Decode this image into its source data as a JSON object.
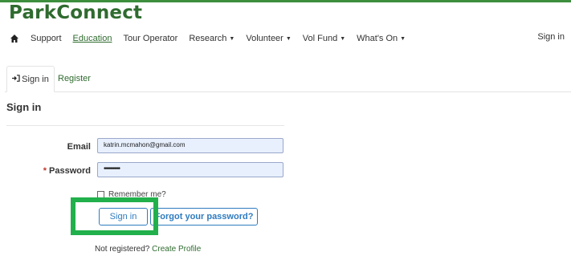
{
  "brand": {
    "name": "ParkConnect",
    "accent_color": "#2f6b2f",
    "topbar_color": "#3d8f3d"
  },
  "nav": {
    "home_icon": "home-icon",
    "items": [
      {
        "label": "Support",
        "dropdown": false
      },
      {
        "label": "Education",
        "dropdown": false,
        "active": true
      },
      {
        "label": "Tour Operator",
        "dropdown": false
      },
      {
        "label": "Research",
        "dropdown": true
      },
      {
        "label": "Volunteer",
        "dropdown": true
      },
      {
        "label": "Vol Fund",
        "dropdown": true
      },
      {
        "label": "What's On",
        "dropdown": true
      }
    ],
    "signin_label": "Sign in"
  },
  "tabs": {
    "signin": {
      "label": "Sign in",
      "icon": "sign-in-icon"
    },
    "register": {
      "label": "Register"
    }
  },
  "page": {
    "title": "Sign in"
  },
  "form": {
    "email": {
      "label": "Email",
      "value": "katrin.mcmahon@gmail.com"
    },
    "password": {
      "label": "Password",
      "required_marker": "*",
      "value": "••••••••"
    },
    "remember_label": "Remember me?",
    "remember_checked": false,
    "signin_button": "Sign in",
    "forgot_button": "Forgot your password?",
    "button_color": "#2f7bbf",
    "highlight_color": "#21b04b"
  },
  "footer": {
    "not_registered": "Not registered?",
    "create_profile": "Create Profile"
  }
}
